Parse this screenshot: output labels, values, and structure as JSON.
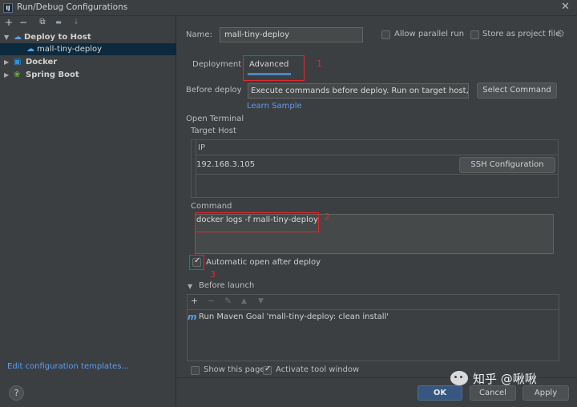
{
  "window": {
    "title": "Run/Debug Configurations",
    "app_icon_text": "IJ"
  },
  "toolbar": {
    "add": "+",
    "remove": "−",
    "copy": "⧉",
    "folder": "▬",
    "sort": "↓"
  },
  "tree": {
    "items": [
      {
        "label": "Deploy to Host",
        "expanded": true
      },
      {
        "label": "mall-tiny-deploy",
        "selected": true
      },
      {
        "label": "Docker",
        "expanded": false
      },
      {
        "label": "Spring Boot",
        "expanded": false
      }
    ],
    "edit_templates": "Edit configuration templates..."
  },
  "form": {
    "name_label": "Name:",
    "name_value": "mall-tiny-deploy",
    "allow_parallel": "Allow parallel run",
    "store_as_project": "Store as project file",
    "tabs": [
      {
        "label": "Deployment",
        "active": false
      },
      {
        "label": "Advanced",
        "active": true
      }
    ],
    "before_deploy_label": "Before deploy",
    "before_deploy_value": "Execute commands before deploy. Run on target host, not lo",
    "select_command": "Select Command",
    "learn_sample": "Learn Sample",
    "open_terminal": "Open Terminal",
    "target_host": "Target Host",
    "ip_header": "IP",
    "ip_value": "192.168.3.105",
    "ssh_config": "SSH Configuration",
    "command_label": "Command",
    "command_value": "docker logs -f mall-tiny-deploy",
    "auto_open": "Automatic open after deploy",
    "before_launch": "Before launch",
    "before_launch_item": "Run Maven Goal 'mall-tiny-deploy: clean install'",
    "show_page": "Show this page",
    "activate_tool": "Activate tool window"
  },
  "annotations": [
    "1",
    "2",
    "3"
  ],
  "buttons": {
    "ok": "OK",
    "cancel": "Cancel",
    "apply": "Apply",
    "help": "?"
  },
  "watermark": {
    "text": "知乎 @啾啾"
  },
  "colors": {
    "accent": "#4a88c7",
    "highlight": "#e0282f",
    "selected": "#0d293e",
    "link": "#589df6"
  }
}
